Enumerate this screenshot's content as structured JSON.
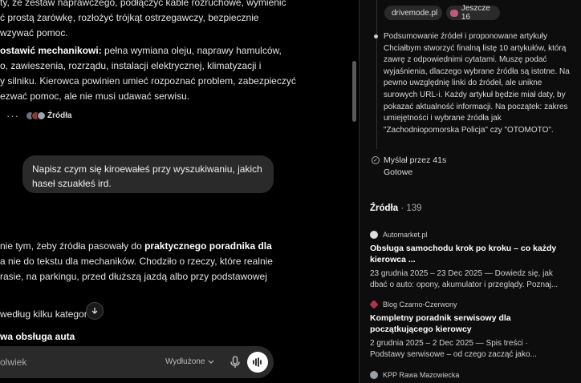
{
  "chat": {
    "p1": {
      "line1": "ty, że zestaw naprawczego, podłączyć kable rozruchowe, wymienić",
      "line2": "ć prostą żarówkę, rozłożyć trójkąt ostrzegawczy, bezpiecznie",
      "line3": "wzywać pomoc."
    },
    "p2": {
      "bold": "ostawić mechanikowi:",
      "line1": " pełna wymiana oleju, naprawy hamulców,",
      "line2": "o, zawieszenia, rozrządu, instalacji elektrycznej, klimatyzacji i",
      "line3": "y silniku. Kierowca powinien umieć rozpoznać problem, zabezpieczyć",
      "line4": "ezwać pomoc, ale nie musi udawać serwisu."
    },
    "actions": {
      "more": "···",
      "sources_label": "Źródła"
    },
    "user_message": "Napisz czym się kiroewałeś przy wyszukiwaniu, jakich haseł szuakłeś ird.",
    "p3": {
      "line1_pre": "nie tym, żeby źródła pasowały do ",
      "line1_bold": "praktycznego poradnika dla",
      "line2": "a nie do tekstu dla mechaników. Chodziło o rzeczy, które realnie",
      "line3": "rasie, na parkingu, przed dłuższą jazdą albo przy podstawowej"
    },
    "p4": {
      "line1": " według kilku kategor"
    },
    "p5": {
      "bold": "wa obsługa auta"
    },
    "composer": {
      "placeholder": "olwiek",
      "model": "Wydłużone"
    }
  },
  "sidebar": {
    "pills": [
      {
        "label": "drivemode.pl"
      },
      {
        "label": "Jeszcze 16"
      }
    ],
    "thinking_text": "Podsumowanie źródeł i proponowane artykuły Chciałbym stworzyć finalną listę 10 artykułów, którą zawrę z odpowiednimi cytatami. Muszę podać wyjaśnienia, dlaczego wybrane źródła są istotne. Na pewno uwzględnię linki do źródeł, ale unikne surowych URL-i. Każdy artykuł będzie miał daty, by pokazać aktualność informacji. Na początek: zakres umiejętności i wybrane źródła jak \"Zachodniopomorska Policja\" czy \"OTOMOTO\".",
    "thought_for": "Myślał przez 41s",
    "done": "Gotowe",
    "sources_title": "Źródła",
    "sources_count": "· 139",
    "sources": [
      {
        "site": "Automarket.pl",
        "title": "Obsługa samochodu krok po kroku – co każdy kierowca ...",
        "snippet1": "23 grudnia 2025 – 23 Dec 2025 — Dowiedz się, jak",
        "snippet2": "dbać o auto: opony, akumulator i przeglądy. Poznaj..."
      },
      {
        "site": "Blog Czarno-Czerwony",
        "title": "Kompletny poradnik serwisowy dla początkującego kierowcy",
        "snippet1": "2 grudnia 2025 – 2 Dec 2025 — Spis treści ·",
        "snippet2": "Podstawy serwisowe – od czego zacząć jako..."
      },
      {
        "site": "KPP Rawa Mazowiecka"
      }
    ]
  }
}
